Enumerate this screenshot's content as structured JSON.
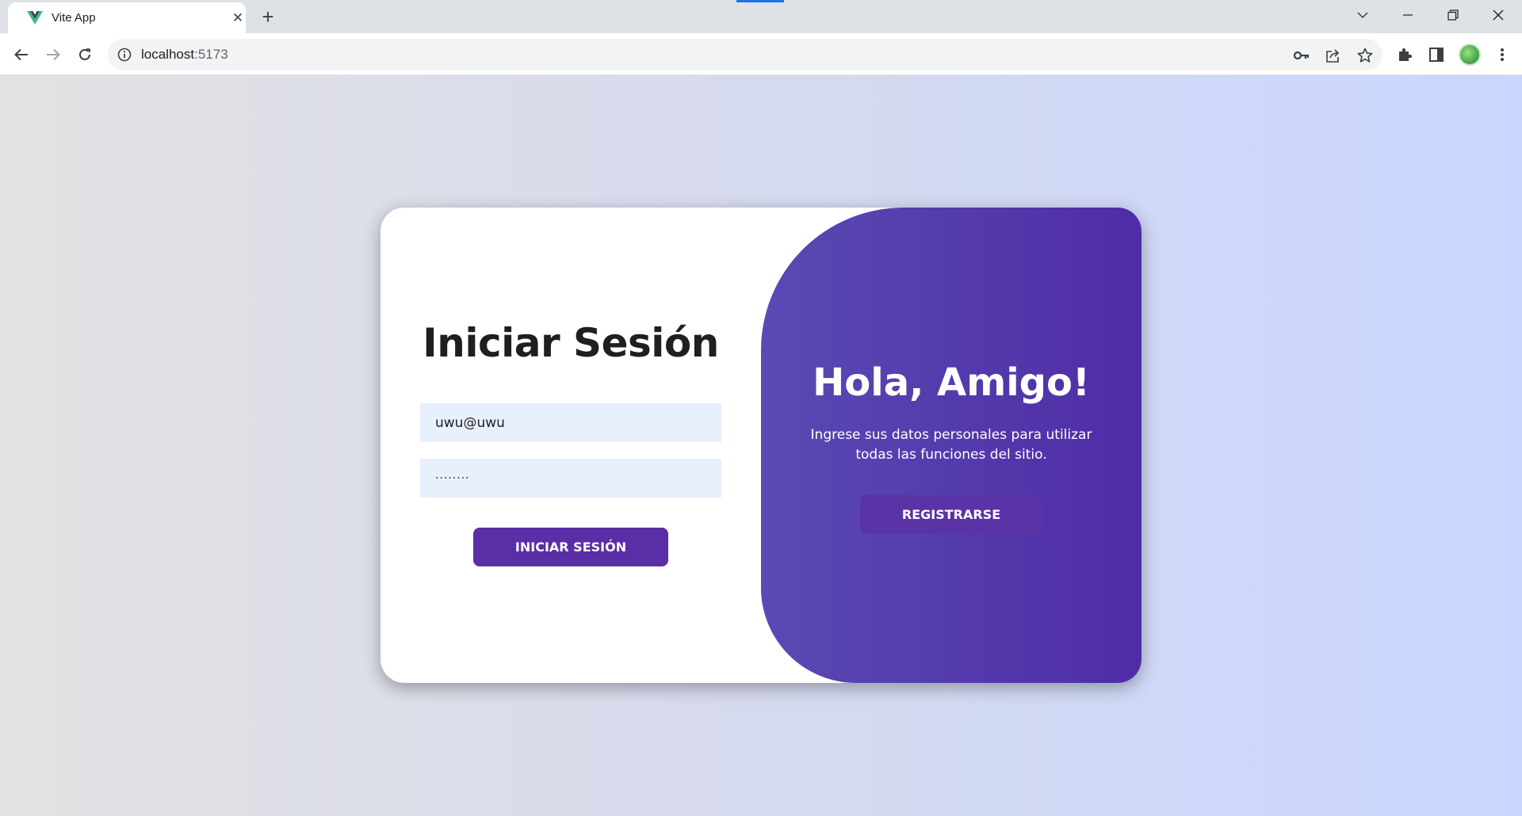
{
  "browser": {
    "tab_title": "Vite App",
    "tab_close": "✕",
    "new_tab": "+",
    "url_host": "localhost",
    "url_port": ":5173",
    "icons": [
      "vue-favicon-icon",
      "back-arrow-icon",
      "forward-arrow-icon",
      "reload-icon",
      "site-info-icon",
      "key-icon",
      "share-icon",
      "star-icon",
      "extensions-icon",
      "side-panel-icon",
      "profile-avatar",
      "more-menu-icon",
      "minimize-icon",
      "restore-icon",
      "close-window-icon",
      "tab-search-icon"
    ]
  },
  "login": {
    "title": "Iniciar Sesión",
    "email_value": "uwu@uwu",
    "password_value": "········",
    "button_label": "INICIAR SESIÓN"
  },
  "welcome": {
    "title": "Hola, Amigo!",
    "text": "Ingrese sus datos personales para utilizar todas las funciones del sitio.",
    "button_label": "REGISTRARSE"
  },
  "colors": {
    "accent": "#5a2ea6",
    "panel_gradient_start": "#5a4ab3",
    "panel_gradient_end": "#4f2ca6",
    "input_bg": "#e8effd"
  }
}
